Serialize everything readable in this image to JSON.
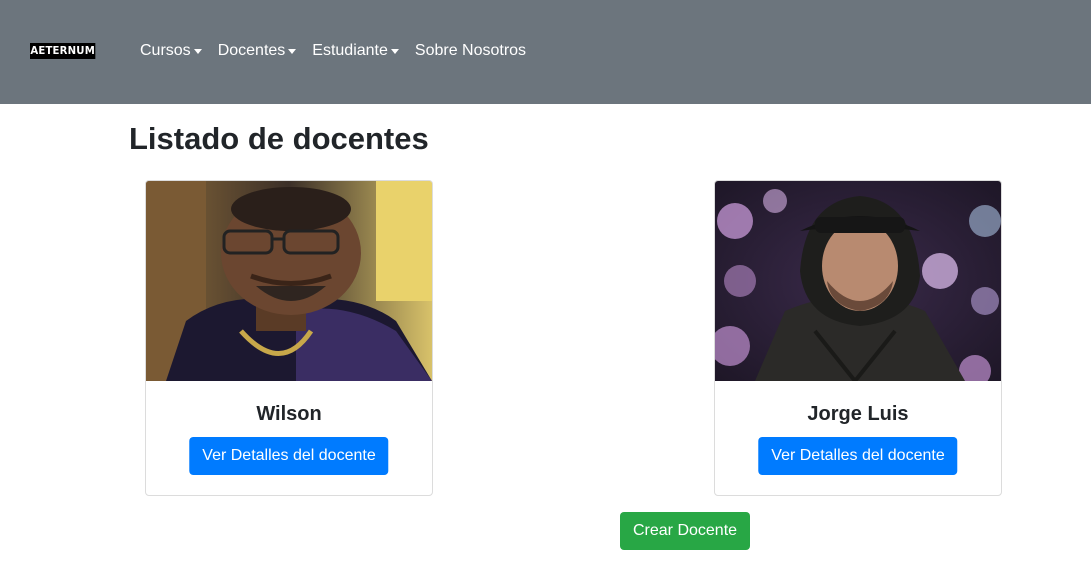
{
  "navbar": {
    "brand": "AETERNUM",
    "items": [
      {
        "label": "Cursos",
        "dropdown": true
      },
      {
        "label": "Docentes",
        "dropdown": true
      },
      {
        "label": "Estudiante",
        "dropdown": true
      },
      {
        "label": "Sobre Nosotros",
        "dropdown": false
      }
    ],
    "background": "#6c757d"
  },
  "page": {
    "title": "Listado de docentes"
  },
  "teachers": [
    {
      "name": "Wilson",
      "button_label": "Ver Detalles del docente"
    },
    {
      "name": "Jorge Luis",
      "button_label": "Ver Detalles del docente"
    }
  ],
  "actions": {
    "create_label": "Crear Docente"
  },
  "colors": {
    "primary": "#007bff",
    "success": "#28a745"
  }
}
